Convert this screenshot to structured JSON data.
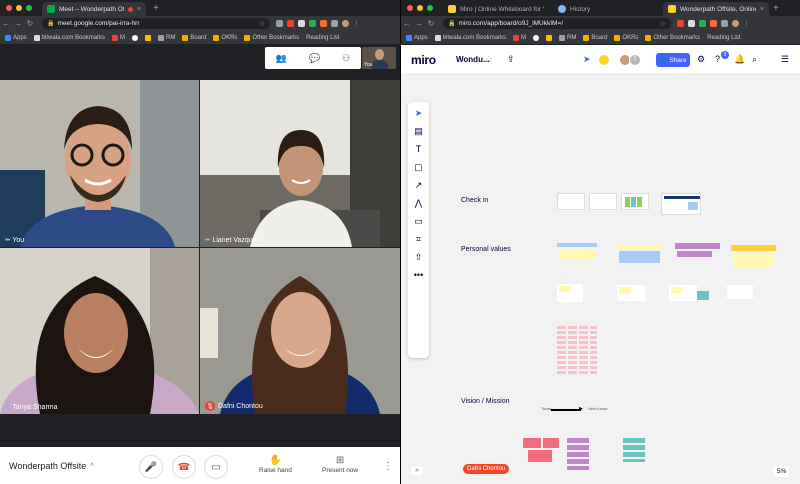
{
  "left_browser": {
    "tab_title": "Meet – Wonderpath Offsite",
    "url": "meet.google.com/pai-irra-hrr",
    "bookmarks": [
      "Apps",
      "bitwala.com Bookmarks",
      "M",
      "",
      "",
      "RM",
      "Board",
      "OKRs",
      "Other Bookmarks",
      "Reading List"
    ]
  },
  "right_browser": {
    "tabs": [
      "Miro | Online Whiteboard for Vi",
      "History",
      "Wonderpath Offsite, Online Wi"
    ],
    "url": "miro.com/app/board/o9J_lMUkkIM=/",
    "bookmarks": [
      "Apps",
      "bitwala.com Bookmarks",
      "M",
      "",
      "",
      "RM",
      "Board",
      "OKRs",
      "Other Bookmarks",
      "Reading List"
    ]
  },
  "meet": {
    "self_label": "You",
    "participants": [
      {
        "name": "You",
        "bg": "#b9b6ad"
      },
      {
        "name": "Lianet Vazquez",
        "bg": "#6d6a63"
      },
      {
        "name": "Tanya Sharma",
        "bg": "#d6d2ca"
      },
      {
        "name": "Dafni Chontou",
        "bg": "#9a9893"
      }
    ],
    "meeting_name": "Wonderpath Offsite",
    "raise_hand": "Raise hand",
    "present_now": "Present now"
  },
  "miro": {
    "logo": "miro",
    "board_name": "Wondu...",
    "share": "Share",
    "avatar_letter": "T",
    "notifications": "9",
    "sections": {
      "check_in": "Check in",
      "personal_values": "Personal values",
      "vision_mission": "Vision / Mission"
    },
    "vision_labels": {
      "today": "Today",
      "next_future": "Next future"
    },
    "cursor_user": "Dafni Chontou",
    "zoom": "5%",
    "expand": "»"
  },
  "colors": {
    "miro_blue": "#4262ff",
    "meet_red": "#ea4335",
    "sticky_yellow": "#fff9b1",
    "sticky_blue": "#a6ccf5",
    "sticky_purple": "#be88c7",
    "sticky_pink": "#f16c7f",
    "sticky_teal": "#67c6c0"
  }
}
